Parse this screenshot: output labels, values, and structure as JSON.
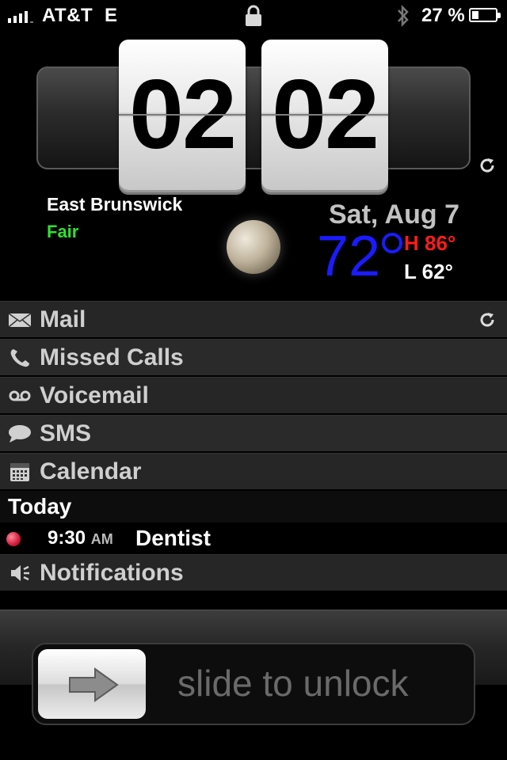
{
  "status_bar": {
    "carrier": "AT&T",
    "network": "E",
    "battery_percent_text": "27 %",
    "battery_level": 0.27,
    "signal_bars": 4,
    "icons": [
      "signal-bars-icon",
      "lock-icon",
      "bluetooth-icon",
      "battery-icon"
    ]
  },
  "clock": {
    "hours": "02",
    "minutes": "02"
  },
  "weather": {
    "city": "East Brunswick",
    "condition": "Fair",
    "date": "Sat, Aug 7",
    "temperature": "72",
    "high": "H 86°",
    "low": "L 62°",
    "colors": {
      "condition": "#2fe32f",
      "temperature": "#1b1bff",
      "high": "#ff1c1c"
    }
  },
  "lockinfo": {
    "rows": [
      {
        "label": "Mail",
        "icon": "mail-icon"
      },
      {
        "label": "Missed Calls",
        "icon": "phone-icon"
      },
      {
        "label": "Voicemail",
        "icon": "voicemail-icon"
      },
      {
        "label": "SMS",
        "icon": "sms-bubble-icon"
      },
      {
        "label": "Calendar",
        "icon": "calendar-icon"
      }
    ],
    "today_label": "Today",
    "event": {
      "time": "9:30",
      "ampm": "AM",
      "title": "Dentist"
    },
    "notifications_label": "Notifications"
  },
  "unlock": {
    "text": "slide to unlock"
  }
}
